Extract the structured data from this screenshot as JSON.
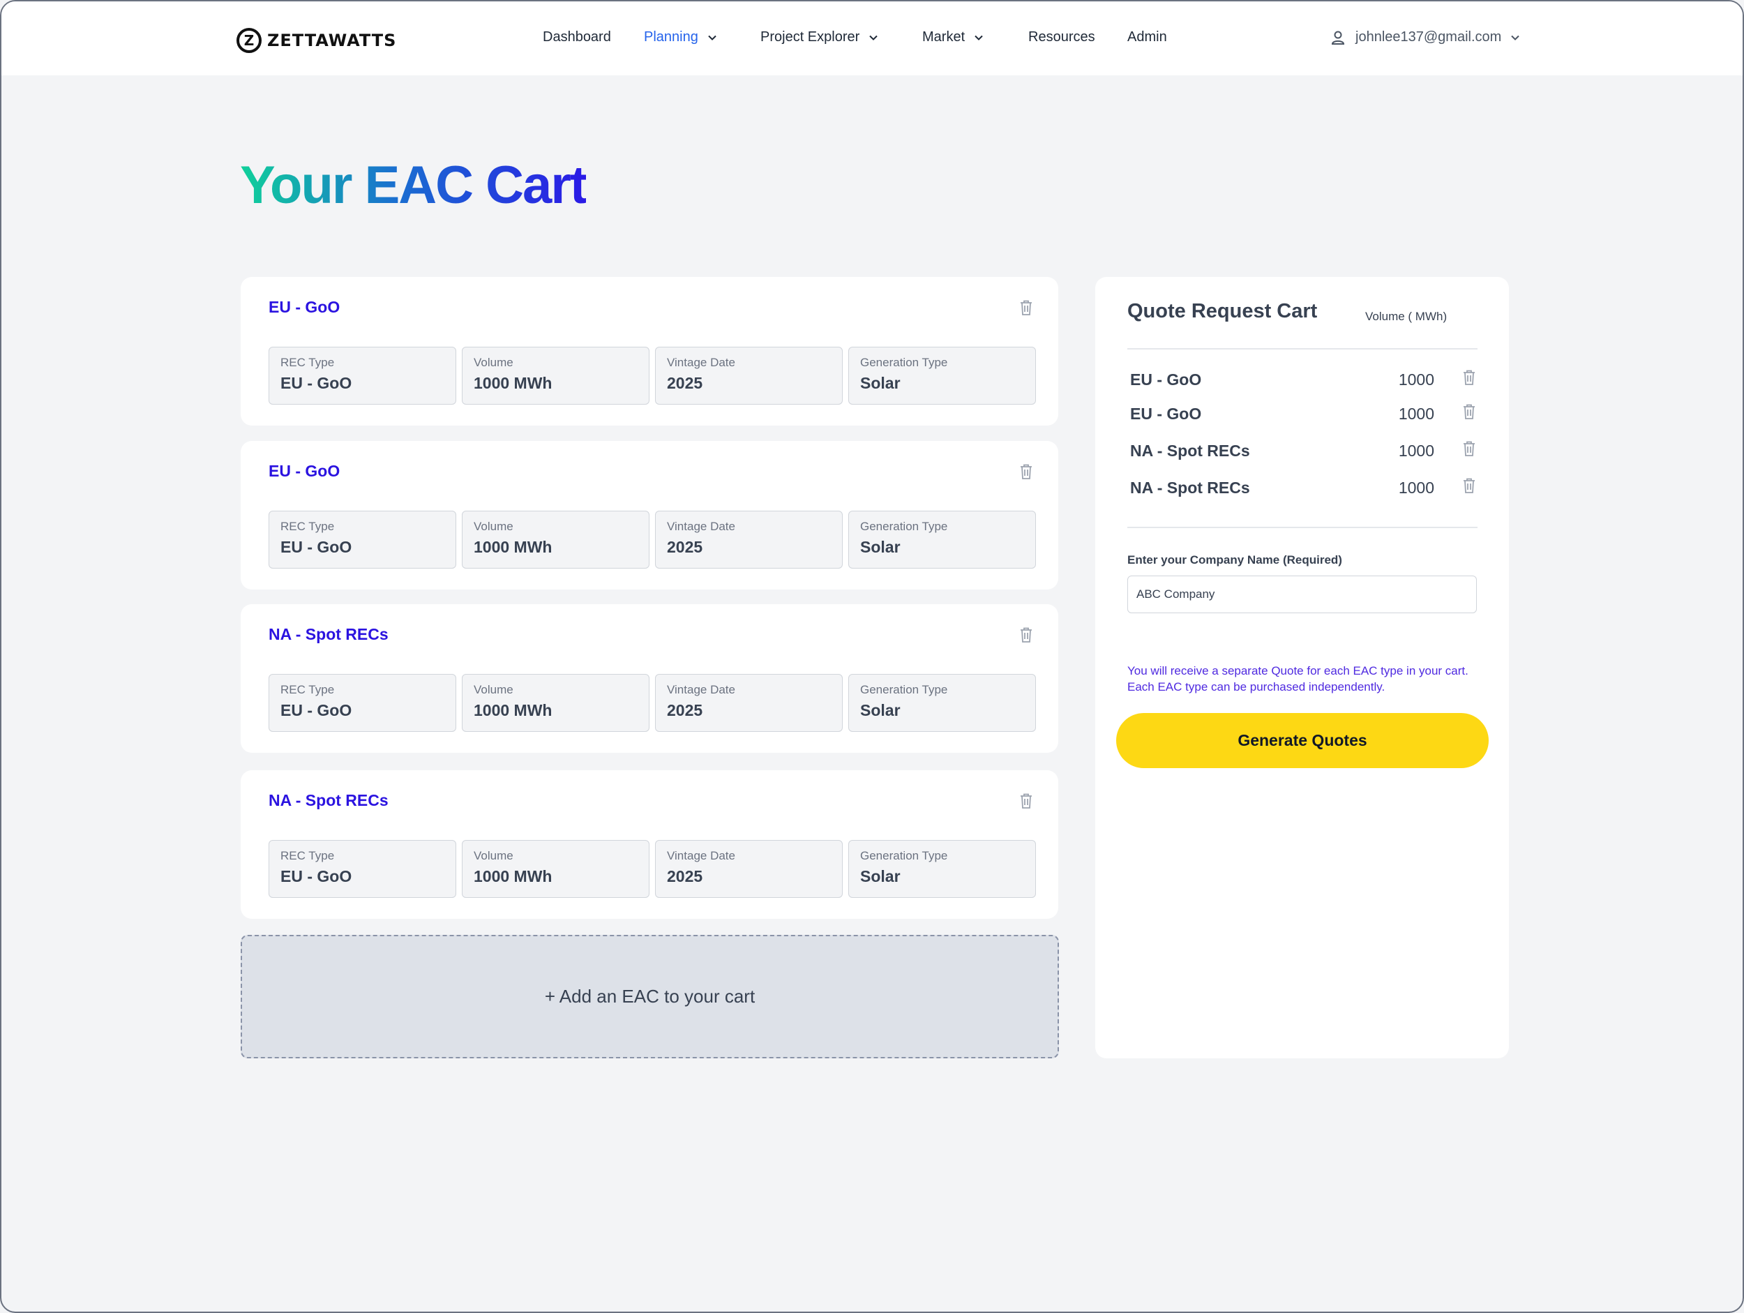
{
  "brand": {
    "name": "ZETTAWATTS"
  },
  "nav": {
    "items": [
      {
        "label": "Dashboard"
      },
      {
        "label": "Planning"
      },
      {
        "label": "Project Explorer"
      },
      {
        "label": "Market"
      },
      {
        "label": "Resources"
      },
      {
        "label": "Admin"
      }
    ],
    "active": "Planning"
  },
  "user": {
    "email": "johnlee137@gmail.com"
  },
  "page": {
    "title": "Your EAC Cart"
  },
  "cart_items": [
    {
      "title": "EU - GoO",
      "fields": [
        {
          "label": "REC Type",
          "value": "EU - GoO"
        },
        {
          "label": "Volume",
          "value": "1000 MWh"
        },
        {
          "label": "Vintage Date",
          "value": "2025"
        },
        {
          "label": "Generation Type",
          "value": "Solar"
        }
      ]
    },
    {
      "title": "EU - GoO",
      "fields": [
        {
          "label": "REC Type",
          "value": "EU - GoO"
        },
        {
          "label": "Volume",
          "value": "1000 MWh"
        },
        {
          "label": "Vintage Date",
          "value": "2025"
        },
        {
          "label": "Generation Type",
          "value": "Solar"
        }
      ]
    },
    {
      "title": "NA - Spot RECs",
      "fields": [
        {
          "label": "REC Type",
          "value": "EU - GoO"
        },
        {
          "label": "Volume",
          "value": "1000 MWh"
        },
        {
          "label": "Vintage Date",
          "value": "2025"
        },
        {
          "label": "Generation Type",
          "value": "Solar"
        }
      ]
    },
    {
      "title": "NA - Spot RECs",
      "fields": [
        {
          "label": "REC Type",
          "value": "EU - GoO"
        },
        {
          "label": "Volume",
          "value": "1000 MWh"
        },
        {
          "label": "Vintage Date",
          "value": "2025"
        },
        {
          "label": "Generation Type",
          "value": "Solar"
        }
      ]
    }
  ],
  "add_item": {
    "label": "+ Add an EAC to your cart"
  },
  "quote_panel": {
    "title": "Quote Request Cart",
    "volume_header": "Volume ( MWh)",
    "rows": [
      {
        "name": "EU - GoO",
        "volume": "1000"
      },
      {
        "name": "EU - GoO",
        "volume": "1000"
      },
      {
        "name": "NA - Spot RECs",
        "volume": "1000"
      },
      {
        "name": "NA - Spot RECs",
        "volume": "1000"
      }
    ],
    "company_label": "Enter your Company Name (Required)",
    "company_value": "ABC Company",
    "notice_line1": "You will receive a separate Quote for each EAC type in your cart.",
    "notice_line2": "Each EAC type can be purchased independently.",
    "button_label": "Generate Quotes"
  },
  "colors": {
    "accent": "#2563eb",
    "item_title": "#2b13e0",
    "button": "#fdd814",
    "background": "#f3f4f6"
  },
  "icons": {
    "trash": "trash-icon",
    "chevron": "chevron-down-icon",
    "user": "user-icon"
  }
}
